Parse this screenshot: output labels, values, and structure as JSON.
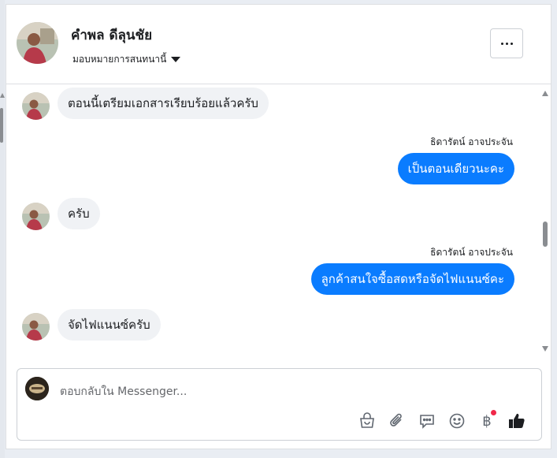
{
  "contact": {
    "name": "คำพล ดีลุนชัย",
    "assign_label": "มอบหมายการสนทนานี้"
  },
  "messages": [
    {
      "direction": "in",
      "text": "ตอนนี้เตรียมเอกสารเรียบร้อยแล้วครับ"
    },
    {
      "direction": "out",
      "sender": "ธิดารัตน์ อาจประจัน",
      "text": "เป็นตอนเดียวนะคะ"
    },
    {
      "direction": "in",
      "text": "ครับ"
    },
    {
      "direction": "out",
      "sender": "ธิดารัตน์ อาจประจัน",
      "text": "ลูกค้าสนใจซื้อสดหรือจัดไฟแนนซ์คะ"
    },
    {
      "direction": "in",
      "text": "จัดไฟแนนซ์ครับ"
    }
  ],
  "composer": {
    "placeholder": "ตอบกลับใน Messenger..."
  },
  "toolbar": {
    "icons": [
      "shop-icon",
      "attachment-icon",
      "saved-reply-icon",
      "emoji-icon",
      "baht-payment-icon",
      "like-icon"
    ],
    "baht_symbol": "฿"
  },
  "colors": {
    "outgoing_bubble": "#0a7cff",
    "incoming_bubble": "#f0f2f5",
    "notification_dot": "#f02849"
  }
}
